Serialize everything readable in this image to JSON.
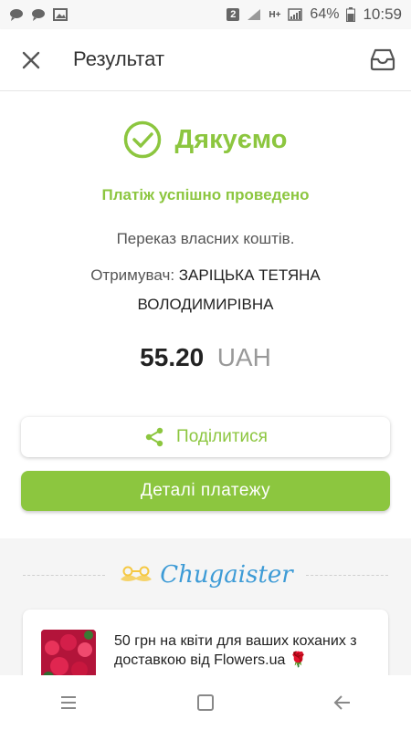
{
  "status_bar": {
    "sim_badge": "2",
    "network": "H+",
    "battery": "64%",
    "time": "10:59"
  },
  "app_bar": {
    "title": "Результат",
    "close_icon": "close-icon",
    "inbox_icon": "inbox-icon"
  },
  "result": {
    "thanks": "Дякуємо",
    "success": "Платіж успішно проведено",
    "description": "Переказ власних коштів.",
    "recipient_label": "Отримувач:",
    "recipient_name": "ЗАРІЦЬКА ТЕТЯНА ВОЛОДИМИРІВНА",
    "amount": "55.20",
    "currency": "UAH"
  },
  "buttons": {
    "share": "Поділитися",
    "details": "Деталі платежу"
  },
  "promo": {
    "brand": "Chugaister",
    "card_text": "50 грн на квіти для ваших коханих з доставкою від Flowers.ua 🌹"
  },
  "colors": {
    "accent": "#8cc63f",
    "brand_blue": "#3d9bd6"
  }
}
